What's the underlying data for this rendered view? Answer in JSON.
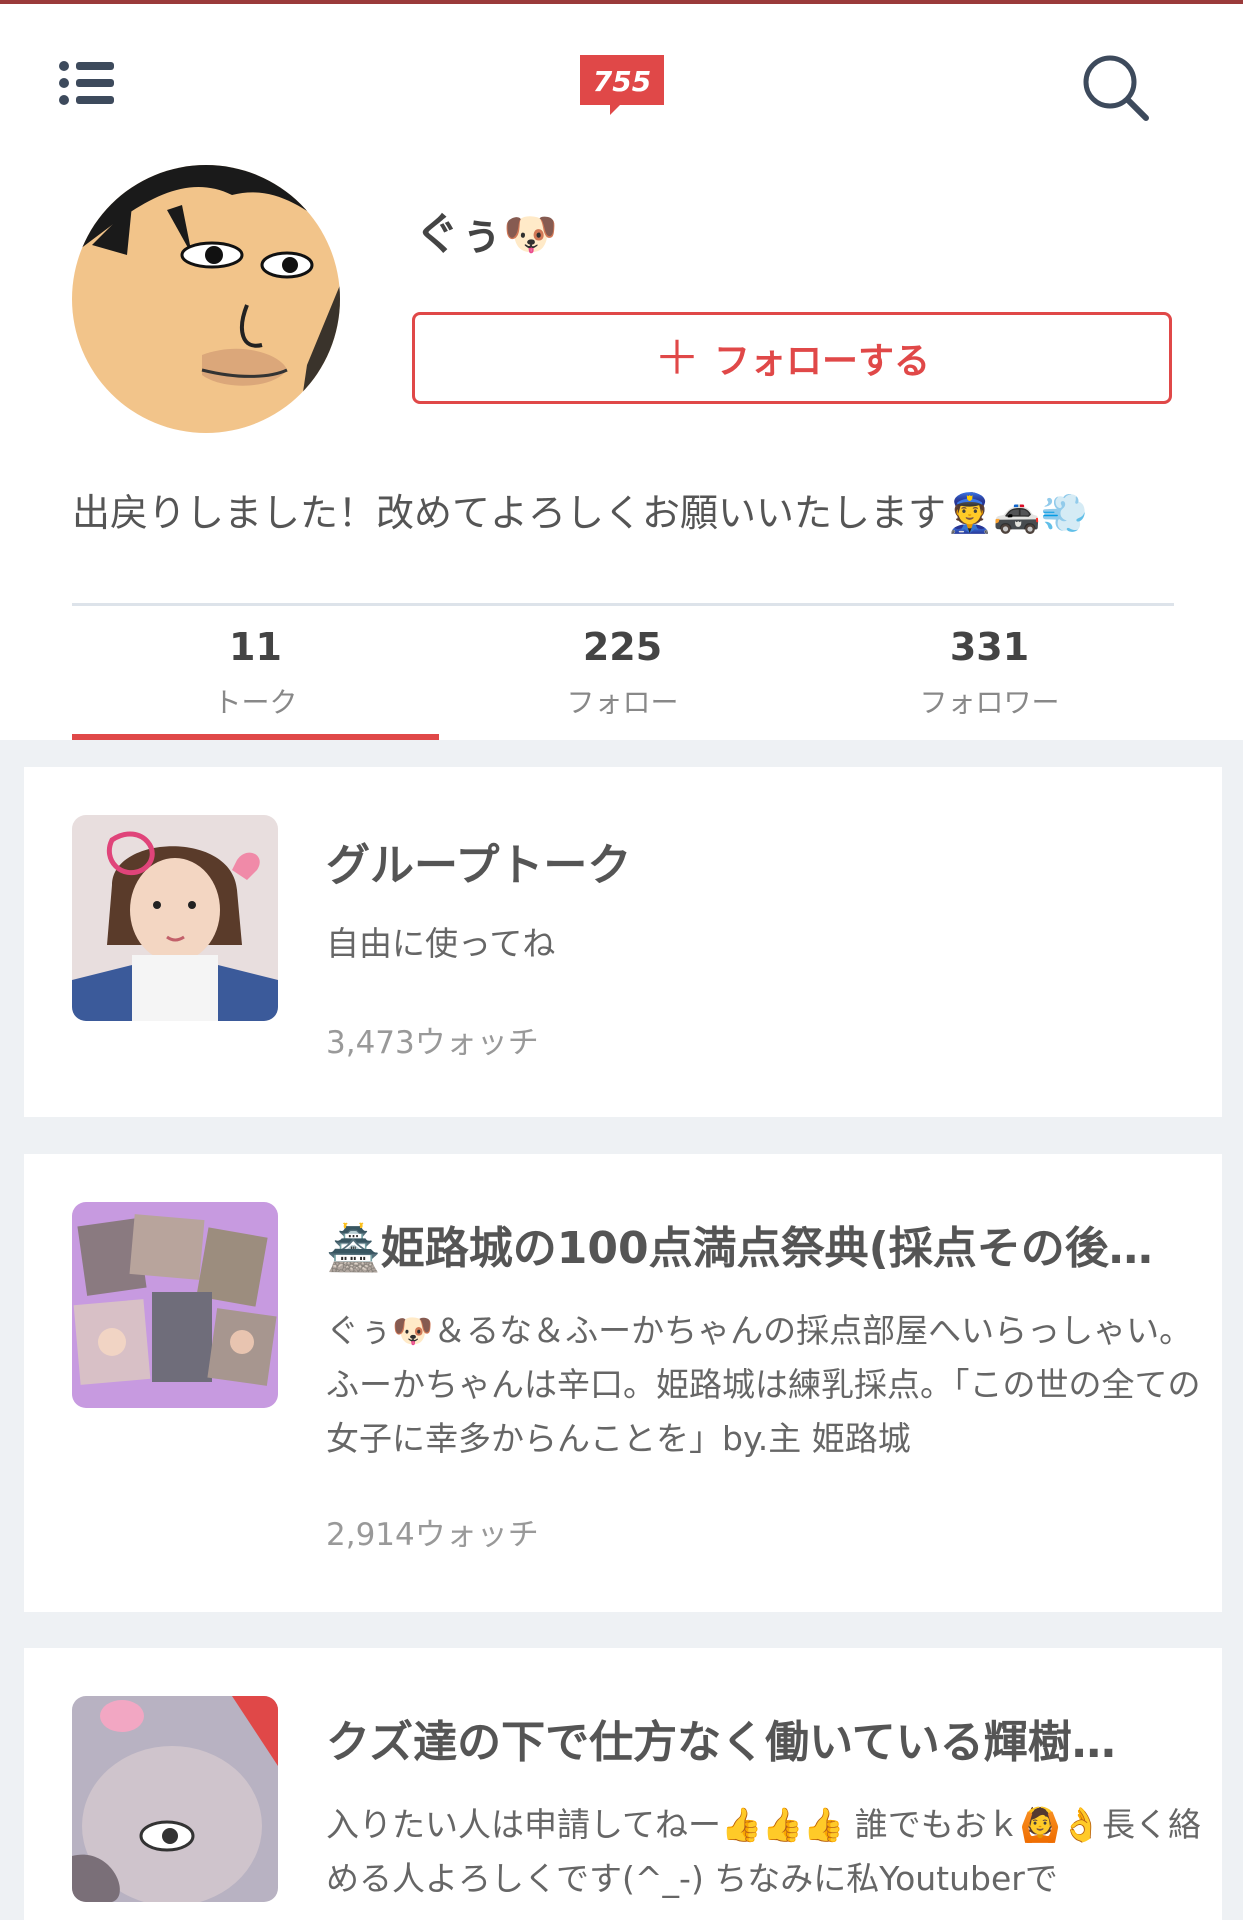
{
  "header": {
    "logo_text": "755",
    "brand_color": "#e04848",
    "menu_icon": "list-icon",
    "search_icon": "search-icon"
  },
  "profile": {
    "name": "ぐぅ🐶",
    "follow_label": "フォローする",
    "bio": "出戻りしました！改めてよろしくお願いいたします👮🚓💨"
  },
  "stats": [
    {
      "num": "11",
      "label": "トーク",
      "active": true
    },
    {
      "num": "225",
      "label": "フォロー",
      "active": false
    },
    {
      "num": "331",
      "label": "フォロワー",
      "active": false
    }
  ],
  "talks": [
    {
      "title": "グループトーク",
      "desc": "自由に使ってね",
      "watch": "3,473ウォッチ"
    },
    {
      "title": "🏯姫路城の100点満点祭典(採点その後…",
      "desc": "ぐぅ🐶＆るな＆ふーかちゃんの採点部屋へいらっしゃい。ふーかちゃんは辛口。姫路城は練乳採点。「この世の全ての女子に幸多からんことを」by.主 姫路城",
      "watch": "2,914ウォッチ"
    },
    {
      "title": "クズ達の下で仕方なく働いている輝樹…",
      "desc": "入りたい人は申請してねー👍👍👍 誰でもおｋ🙆👌長く絡める人よろしくです(^_-) ちなみに私Youtuberで",
      "watch": ""
    }
  ]
}
